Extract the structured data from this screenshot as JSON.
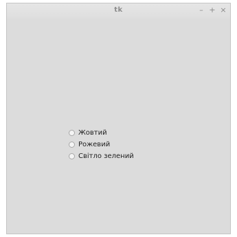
{
  "window": {
    "title": "tk",
    "controls": {
      "minimize": "–",
      "maximize": "+",
      "close": "×"
    }
  },
  "radio_group": {
    "options": [
      {
        "label": "Жовтий",
        "selected": false
      },
      {
        "label": "Рожевий",
        "selected": false
      },
      {
        "label": "Світло зелений",
        "selected": false
      }
    ]
  }
}
